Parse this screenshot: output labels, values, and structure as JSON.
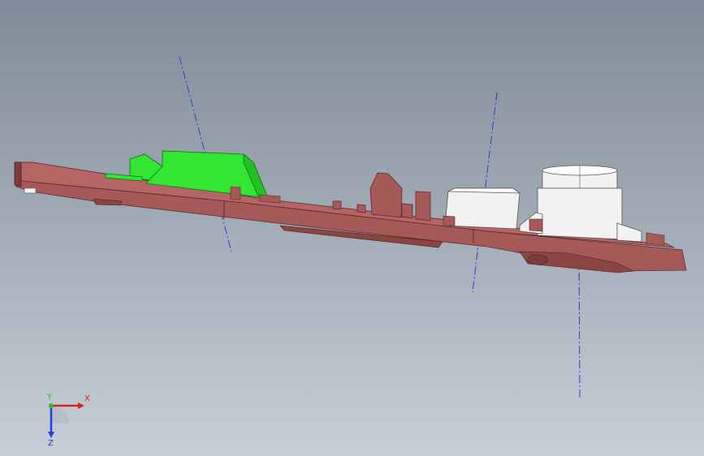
{
  "viewport": {
    "background_top": "#7f8b98",
    "background_bottom": "#c7ced6"
  },
  "model": {
    "body_color": "#a65a58",
    "body_dark_color": "#7a3d3b",
    "highlight_part_color": "#33e633",
    "white_part_color": "#f2f2f2"
  },
  "axes_lines": {
    "color": "#2a3cd6",
    "style": "dash-dot"
  },
  "triad": {
    "x_label": "X",
    "y_label": "Y",
    "z_label": "Z",
    "x_color": "#e02020",
    "y_color": "#20c020",
    "z_color": "#2040e0"
  }
}
